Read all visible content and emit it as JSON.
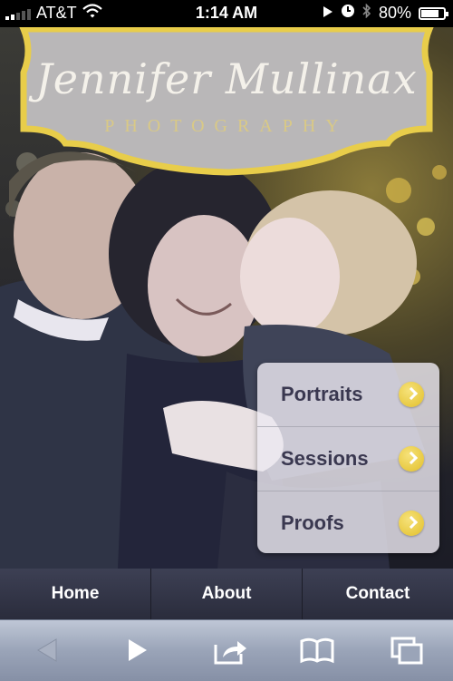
{
  "status_bar": {
    "carrier": "AT&T",
    "time": "1:14 AM",
    "battery": "80%",
    "battery_level": 0.8,
    "signal_bars": 2
  },
  "logo": {
    "script": "Jennifer Mullinax",
    "subtitle": "PHOTOGRAPHY",
    "frame_color": "#e8cd4a",
    "plate_color": "#b9b7b8"
  },
  "menu": {
    "items": [
      {
        "label": "Portraits"
      },
      {
        "label": "Sessions"
      },
      {
        "label": "Proofs"
      }
    ],
    "accent_color": "#e9c83a"
  },
  "nav": {
    "items": [
      {
        "label": "Home"
      },
      {
        "label": "About"
      },
      {
        "label": "Contact"
      }
    ]
  },
  "toolbar": {
    "icons": [
      "back-icon",
      "forward-icon",
      "share-icon",
      "bookmarks-icon",
      "tabs-icon"
    ]
  }
}
